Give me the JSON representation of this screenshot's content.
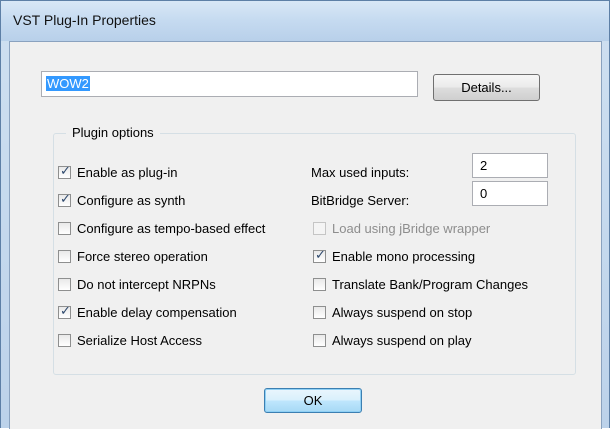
{
  "window": {
    "title": "VST Plug-In Properties"
  },
  "name_field": {
    "value": "WOW2"
  },
  "details_button": {
    "label": "Details..."
  },
  "plugin_options": {
    "title": "Plugin options",
    "left_checkboxes": [
      {
        "label": "Enable as plug-in",
        "checked": true
      },
      {
        "label": "Configure as synth",
        "checked": true
      },
      {
        "label": "Configure as tempo-based effect",
        "checked": false
      },
      {
        "label": "Force stereo operation",
        "checked": false
      },
      {
        "label": "Do not intercept NRPNs",
        "checked": false
      },
      {
        "label": "Enable delay compensation",
        "checked": true
      },
      {
        "label": "Serialize Host Access",
        "checked": false
      }
    ],
    "max_used_inputs": {
      "label": "Max used inputs:",
      "value": "2"
    },
    "bitbridge_server": {
      "label": "BitBridge Server:",
      "value": "0"
    },
    "right_checkboxes": [
      {
        "label": "Load using jBridge wrapper",
        "checked": false,
        "disabled": true
      },
      {
        "label": "Enable mono processing",
        "checked": true,
        "disabled": false
      },
      {
        "label": "Translate Bank/Program Changes",
        "checked": false,
        "disabled": false
      },
      {
        "label": "Always suspend on stop",
        "checked": false,
        "disabled": false
      },
      {
        "label": "Always suspend on play",
        "checked": false,
        "disabled": false
      }
    ]
  },
  "ok_button": {
    "label": "OK"
  },
  "icons": {
    "check_mark": "✓"
  }
}
